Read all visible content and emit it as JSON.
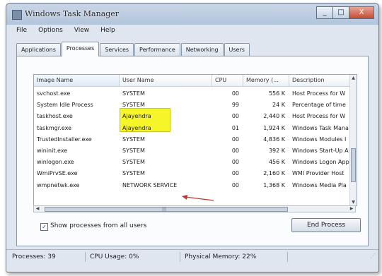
{
  "window": {
    "title": "Windows Task Manager",
    "controls": [
      "_",
      "□",
      "X"
    ]
  },
  "menu": [
    "File",
    "Options",
    "View",
    "Help"
  ],
  "tabs": [
    {
      "label": "Applications",
      "active": false
    },
    {
      "label": "Processes",
      "active": true
    },
    {
      "label": "Services",
      "active": false
    },
    {
      "label": "Performance",
      "active": false
    },
    {
      "label": "Networking",
      "active": false
    },
    {
      "label": "Users",
      "active": false
    }
  ],
  "table": {
    "columns": [
      "Image Name",
      "User Name",
      "CPU",
      "Memory (...",
      "Description"
    ],
    "rows": [
      {
        "image": "svchost.exe",
        "user": "SYSTEM",
        "cpu": "00",
        "memory": "556 K",
        "description": "Host Process for W"
      },
      {
        "image": "System Idle Process",
        "user": "SYSTEM",
        "cpu": "99",
        "memory": "24 K",
        "description": "Percentage of time"
      },
      {
        "image": "taskhost.exe",
        "user": "Ajayendra",
        "cpu": "00",
        "memory": "2,440 K",
        "description": "Host Process for W"
      },
      {
        "image": "taskmgr.exe",
        "user": "Ajayendra",
        "cpu": "01",
        "memory": "1,924 K",
        "description": "Windows Task Mana"
      },
      {
        "image": "TrustedInstaller.exe",
        "user": "SYSTEM",
        "cpu": "00",
        "memory": "4,836 K",
        "description": "Windows Modules I"
      },
      {
        "image": "wininit.exe",
        "user": "SYSTEM",
        "cpu": "00",
        "memory": "392 K",
        "description": "Windows Start-Up A"
      },
      {
        "image": "winlogon.exe",
        "user": "SYSTEM",
        "cpu": "00",
        "memory": "456 K",
        "description": "Windows Logon App"
      },
      {
        "image": "WmiPrvSE.exe",
        "user": "SYSTEM",
        "cpu": "00",
        "memory": "2,160 K",
        "description": "WMI Provider Host"
      },
      {
        "image": "wmpnetwk.exe",
        "user": "NETWORK SERVICE",
        "cpu": "00",
        "memory": "1,368 K",
        "description": "Windows Media Pla"
      }
    ]
  },
  "show_all_users": {
    "label": "Show processes from all users",
    "checked": true
  },
  "end_process_label": "End Process",
  "status": {
    "processes": "Processes: 39",
    "cpu": "CPU Usage: 0%",
    "memory": "Physical Memory: 22%"
  },
  "colors": {
    "highlight": "#f5f52a",
    "annotation_arrow": "#c0392b"
  }
}
